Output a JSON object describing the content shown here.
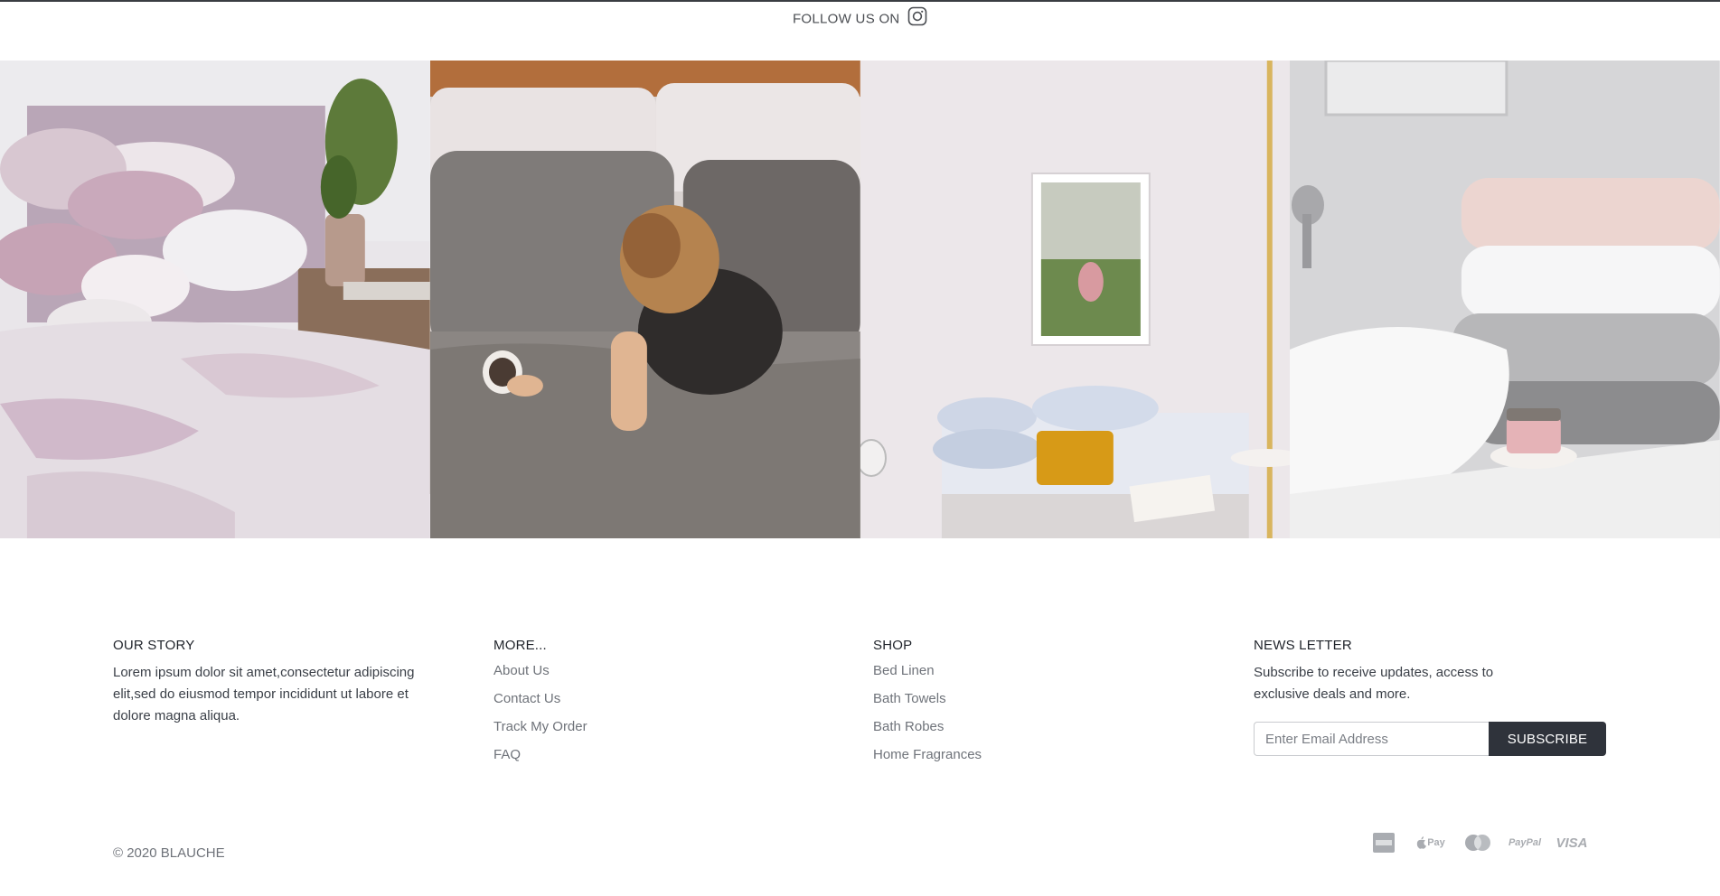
{
  "header": {
    "follow_label": "FOLLOW US ON",
    "follow_icon": "instagram-icon"
  },
  "gallery": {
    "images": [
      {
        "name": "bedroom-lilac-bedding"
      },
      {
        "name": "woman-in-bed-with-coffee"
      },
      {
        "name": "white-bedroom-with-artwork"
      },
      {
        "name": "bathroom-towels-and-basin"
      }
    ]
  },
  "footer": {
    "story": {
      "heading": "OUR STORY",
      "text": "Lorem ipsum dolor sit amet,consectetur adipiscing elit,sed do eiusmod tempor incididunt ut labore et dolore magna aliqua."
    },
    "more": {
      "heading": "MORE...",
      "links": [
        "About Us",
        "Contact Us",
        "Track My Order",
        "FAQ"
      ]
    },
    "shop": {
      "heading": "SHOP",
      "links": [
        "Bed Linen",
        "Bath Towels",
        "Bath Robes",
        "Home Fragrances"
      ]
    },
    "newsletter": {
      "heading": "NEWS LETTER",
      "text": "Subscribe to receive updates, access to exclusive deals and more.",
      "placeholder": "Enter Email Address",
      "button": "SUBSCRIBE"
    },
    "copyright": "© 2020 BLAUCHE",
    "payments": [
      "amex-icon",
      "apple-pay-icon",
      "mastercard-icon",
      "paypal-icon",
      "visa-icon"
    ],
    "payment_labels": {
      "apple": "Pay",
      "paypal": "PayPal",
      "visa": "VISA"
    }
  }
}
